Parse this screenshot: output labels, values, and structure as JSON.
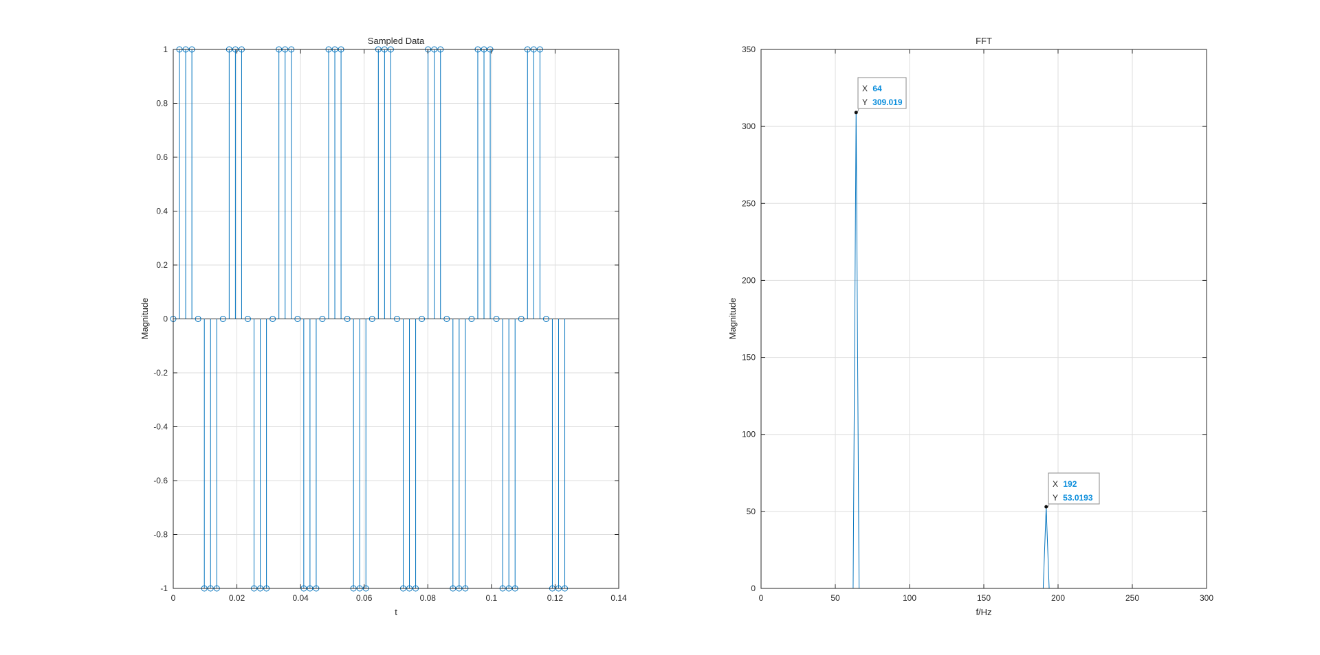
{
  "colors": {
    "series": "#0072BD",
    "axis": "#262626",
    "grid": "#dedede",
    "datatip_value": "#0e8fdc",
    "datatip_bg": "#ffffff",
    "datatip_border": "#888888"
  },
  "chart_data": [
    {
      "type": "stem",
      "title": "Sampled Data",
      "xlabel": "t",
      "ylabel": "Magnitude",
      "xlim": [
        0,
        0.14
      ],
      "ylim": [
        -1,
        1
      ],
      "xticks": [
        "0",
        "0.02",
        "0.04",
        "0.06",
        "0.08",
        "0.1",
        "0.12",
        "0.14"
      ],
      "yticks": [
        "-1",
        "-0.8",
        "-0.6",
        "-0.4",
        "-0.2",
        "0",
        "0.2",
        "0.4",
        "0.6",
        "0.8",
        "1"
      ],
      "grid": true,
      "sample_period": 0.001953125,
      "pattern": [
        0,
        1,
        1,
        1,
        0,
        -1,
        -1,
        -1
      ],
      "n_samples": 64,
      "marker": "circle"
    },
    {
      "type": "line",
      "title": "FFT",
      "xlabel": "f/Hz",
      "ylabel": "Magnitude",
      "xlim": [
        0,
        300
      ],
      "ylim": [
        0,
        350
      ],
      "xticks": [
        "0",
        "50",
        "100",
        "150",
        "200",
        "250",
        "300"
      ],
      "yticks": [
        "0",
        "50",
        "100",
        "150",
        "200",
        "250",
        "300",
        "350"
      ],
      "grid": true,
      "x": [
        0,
        62,
        64,
        66,
        190,
        192,
        194,
        256
      ],
      "y": [
        0,
        0,
        309.019,
        0,
        0,
        53.0193,
        0,
        0
      ],
      "datatips": [
        {
          "x_label": "X",
          "x_value": "64",
          "y_label": "Y",
          "y_value": "309.019",
          "x": 64,
          "y": 309.019
        },
        {
          "x_label": "X",
          "x_value": "192",
          "y_label": "Y",
          "y_value": "53.0193",
          "x": 192,
          "y": 53.0193
        }
      ]
    }
  ]
}
